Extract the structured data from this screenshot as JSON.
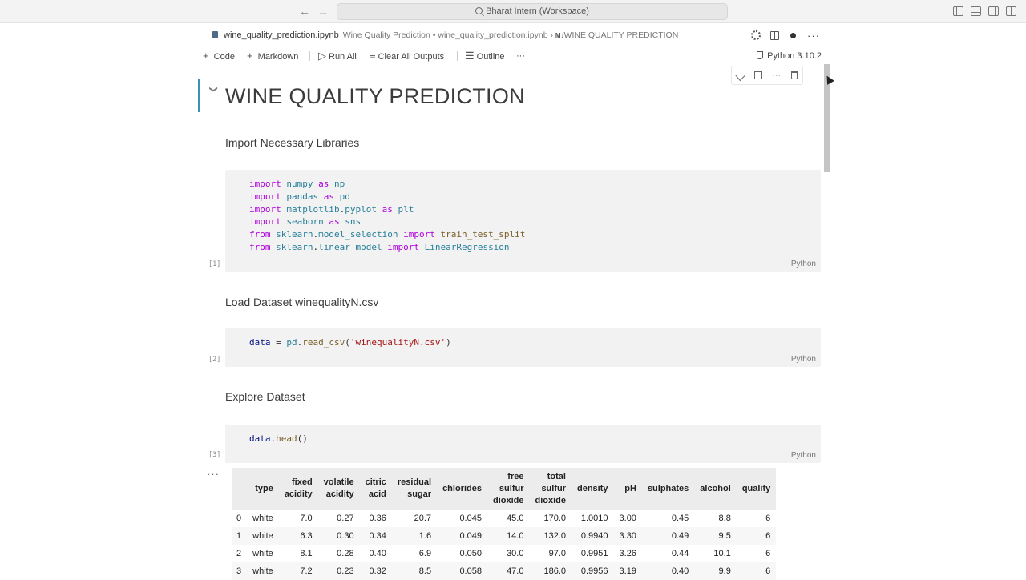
{
  "titlebar": {
    "workspace_title": "Bharat Intern (Workspace)",
    "back_icon": "arrow-left-icon",
    "forward_icon": "arrow-right-icon"
  },
  "tab": {
    "filename": "wine_quality_prediction.ipynb",
    "breadcrumb_path": "Wine Quality Prediction • wine_quality_prediction.ipynb › ",
    "breadcrumb_badge": "M↓",
    "breadcrumb_section": "WINE QUALITY PREDICTION"
  },
  "toolbar": {
    "code_label": "Code",
    "markdown_label": "Markdown",
    "run_all_label": "Run All",
    "clear_outputs_label": "Clear All Outputs",
    "outline_label": "Outline",
    "more_label": "···",
    "kernel_label": "Python 3.10.2"
  },
  "notebook": {
    "title": "WINE QUALITY PREDICTION",
    "sections": [
      {
        "heading": "Import Necessary Libraries",
        "exec_count": "[1]",
        "lang": "Python"
      },
      {
        "heading": "Load Dataset winequalityN.csv",
        "exec_count": "[2]",
        "lang": "Python"
      },
      {
        "heading": "Explore Dataset",
        "exec_count": "[3]",
        "lang": "Python"
      }
    ],
    "output_more": "···"
  },
  "dataframe": {
    "columns": [
      [
        "type"
      ],
      [
        "fixed",
        "acidity"
      ],
      [
        "volatile",
        "acidity"
      ],
      [
        "citric",
        "acid"
      ],
      [
        "residual",
        "sugar"
      ],
      [
        "chlorides"
      ],
      [
        "free",
        "sulfur",
        "dioxide"
      ],
      [
        "total",
        "sulfur",
        "dioxide"
      ],
      [
        "density"
      ],
      [
        "pH"
      ],
      [
        "sulphates"
      ],
      [
        "alcohol"
      ],
      [
        "quality"
      ]
    ],
    "rows": [
      [
        "0",
        "white",
        "7.0",
        "0.27",
        "0.36",
        "20.7",
        "0.045",
        "45.0",
        "170.0",
        "1.0010",
        "3.00",
        "0.45",
        "8.8",
        "6"
      ],
      [
        "1",
        "white",
        "6.3",
        "0.30",
        "0.34",
        "1.6",
        "0.049",
        "14.0",
        "132.0",
        "0.9940",
        "3.30",
        "0.49",
        "9.5",
        "6"
      ],
      [
        "2",
        "white",
        "8.1",
        "0.28",
        "0.40",
        "6.9",
        "0.050",
        "30.0",
        "97.0",
        "0.9951",
        "3.26",
        "0.44",
        "10.1",
        "6"
      ],
      [
        "3",
        "white",
        "7.2",
        "0.23",
        "0.32",
        "8.5",
        "0.058",
        "47.0",
        "186.0",
        "0.9956",
        "3.19",
        "0.40",
        "9.9",
        "6"
      ]
    ]
  }
}
